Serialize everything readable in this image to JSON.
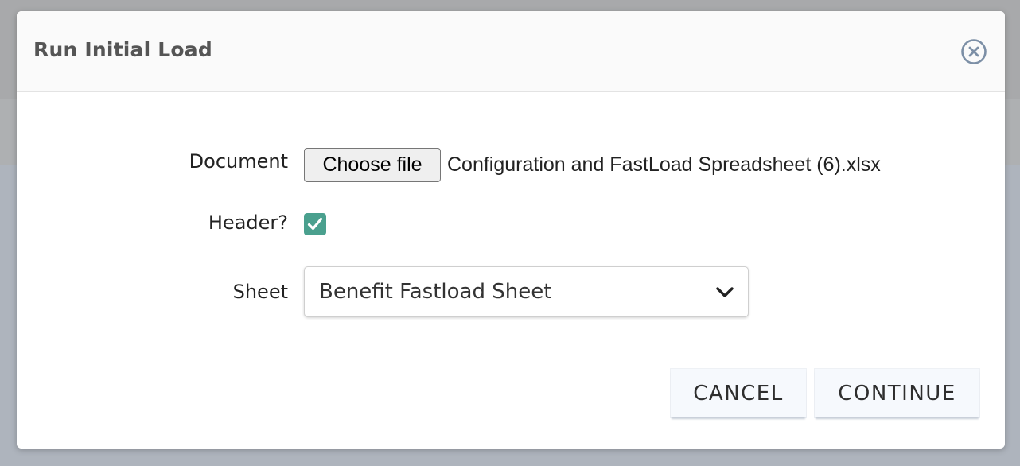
{
  "dialog": {
    "title": "Run Initial Load",
    "close_icon": "close-circle-icon"
  },
  "form": {
    "document": {
      "label": "Document",
      "button_label": "Choose file",
      "file_name": "Configuration and FastLoad Spreadsheet (6).xlsx"
    },
    "header": {
      "label": "Header?",
      "checked": true,
      "check_icon": "checkmark-icon"
    },
    "sheet": {
      "label": "Sheet",
      "selected_value": "Benefit Fastload Sheet",
      "chevron_icon": "chevron-down-icon"
    }
  },
  "actions": {
    "cancel_label": "CANCEL",
    "continue_label": "CONTINUE"
  },
  "colors": {
    "checkbox_accent": "#4aa08e",
    "close_icon": "#7c8fa6",
    "button_background": "#f6f9fd"
  }
}
